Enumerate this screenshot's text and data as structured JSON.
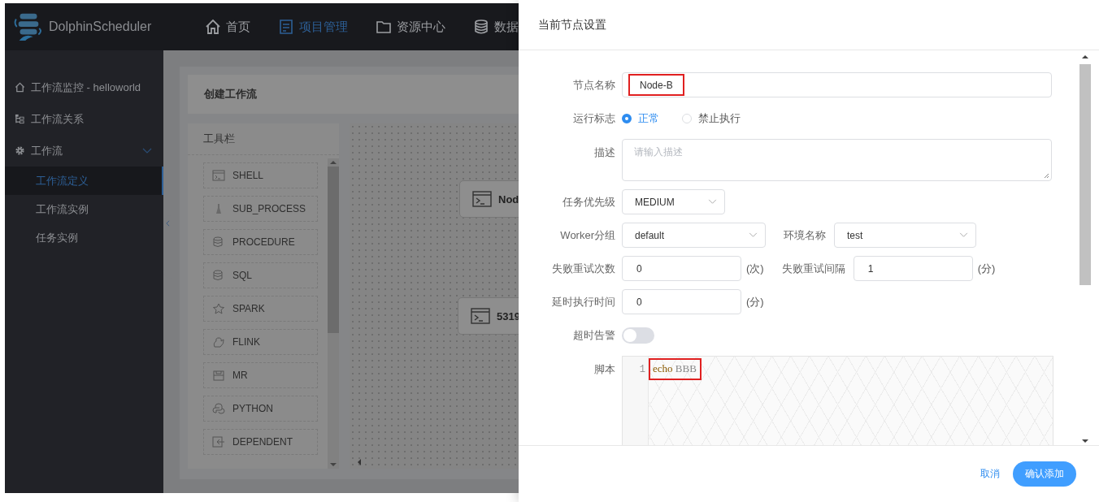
{
  "header": {
    "logo_text": "DolphinScheduler",
    "nav": [
      {
        "label": "首页",
        "kind": "home",
        "selected": false
      },
      {
        "label": "项目管理",
        "kind": "document",
        "selected": true
      },
      {
        "label": "资源中心",
        "kind": "folder",
        "selected": false
      },
      {
        "label": "数据",
        "kind": "database",
        "selected": false
      }
    ]
  },
  "sidebar": {
    "items": [
      {
        "label": "工作流监控 - helloworld",
        "kind": "home"
      },
      {
        "label": "工作流关系",
        "kind": "tree"
      },
      {
        "label": "工作流",
        "kind": "gear",
        "expanded": true,
        "children": [
          {
            "label": "工作流定义",
            "selected": true
          },
          {
            "label": "工作流实例",
            "selected": false
          },
          {
            "label": "任务实例",
            "selected": false
          }
        ]
      }
    ]
  },
  "workspace": {
    "title": "创建工作流",
    "toolbar": {
      "title": "工具栏",
      "items": [
        {
          "label": "SHELL",
          "kind": "terminal"
        },
        {
          "label": "SUB_PROCESS",
          "kind": "flask"
        },
        {
          "label": "PROCEDURE",
          "kind": "database"
        },
        {
          "label": "SQL",
          "kind": "database"
        },
        {
          "label": "SPARK",
          "kind": "star"
        },
        {
          "label": "FLINK",
          "kind": "squirrel"
        },
        {
          "label": "MR",
          "kind": "box"
        },
        {
          "label": "PYTHON",
          "kind": "python"
        },
        {
          "label": "DEPENDENT",
          "kind": "dependent"
        }
      ]
    },
    "nodes": [
      {
        "label": "Nod"
      },
      {
        "label": "5319"
      }
    ]
  },
  "drawer": {
    "title": "当前节点设置",
    "rows": [
      {
        "fields": [
          {
            "kind": "input",
            "label": "节点名称",
            "value": "Node-B",
            "highlighted": true
          }
        ]
      },
      {
        "fields": [
          {
            "kind": "radio",
            "label": "运行标志",
            "options": [
              {
                "label": "正常",
                "selected": true
              },
              {
                "label": "禁止执行",
                "selected": false
              }
            ]
          }
        ]
      },
      {
        "fields": [
          {
            "kind": "textarea",
            "label": "描述",
            "placeholder": "请输入描述"
          }
        ]
      },
      {
        "fields": [
          {
            "kind": "select",
            "label": "任务优先级",
            "value": "MEDIUM"
          }
        ]
      },
      {
        "fields": [
          {
            "kind": "select",
            "label": "Worker分组",
            "value": "default"
          },
          {
            "kind": "select",
            "label": "环境名称",
            "value": "test"
          }
        ]
      },
      {
        "fields": [
          {
            "kind": "input",
            "label": "失败重试次数",
            "value": "0",
            "unit": "(次)"
          },
          {
            "kind": "input",
            "label": "失败重试间隔",
            "value": "1",
            "unit": "(分)"
          }
        ]
      },
      {
        "fields": [
          {
            "kind": "input",
            "label": "延时执行时间",
            "value": "0",
            "unit": "(分)"
          }
        ]
      },
      {
        "fields": [
          {
            "kind": "switch",
            "label": "超时告警",
            "on": false
          }
        ]
      },
      {
        "fields": [
          {
            "kind": "code",
            "label": "脚本",
            "lines": [
              {
                "number": "1",
                "highlighted": true,
                "tokens": [
                  {
                    "text": "echo",
                    "kind": "keyword"
                  },
                  {
                    "text": "BBB",
                    "kind": "plain"
                  }
                ]
              }
            ]
          }
        ]
      }
    ],
    "cancel": "取消",
    "confirm": "确认添加"
  }
}
